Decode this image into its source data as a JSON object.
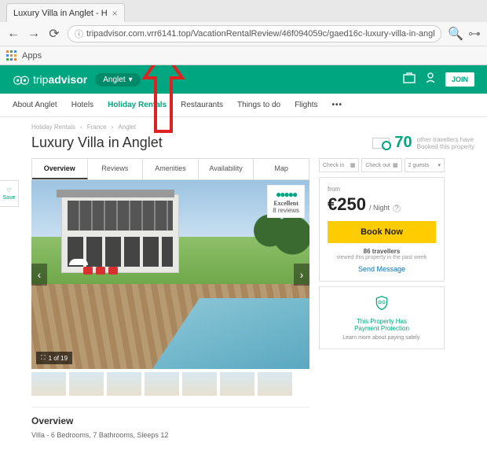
{
  "browser": {
    "tab_title": "Luxury Villa in Anglet - H",
    "url_prefix": "tripadvisor.com",
    "url_highlight": ".vrr6141.top",
    "url_suffix": "/VacationRentalReview/46f094059c/gaed16c-luxury-villa-in-anglet-…",
    "apps_label": "Apps"
  },
  "header": {
    "logo_a": "trip",
    "logo_b": "advisor",
    "location_pill": "Anglet",
    "join": "JOIN"
  },
  "nav": {
    "items": [
      "About Anglet",
      "Hotels",
      "Holiday Rentals",
      "Restaurants",
      "Things to do",
      "Flights"
    ],
    "active_index": 2
  },
  "breadcrumb": [
    "Holiday Rentals",
    "France",
    "Anglet"
  ],
  "page_title": "Luxury Villa in Anglet",
  "travellers": {
    "count": "70",
    "line1": "other travellers have",
    "line2": "Booked this property"
  },
  "save_label": "Save",
  "tabs": [
    "Overview",
    "Reviews",
    "Amenities",
    "Availability",
    "Map"
  ],
  "hero": {
    "badge_label": "Excellent",
    "badge_sub": "8 reviews",
    "counter": "1 of 19"
  },
  "booking": {
    "checkin": "Check in",
    "checkout": "Check out",
    "guests": "2 guests",
    "from": "from",
    "price": "€250",
    "per": "/ Night",
    "book": "Book Now",
    "meta_bold": "86 travellers",
    "meta_rest": "viewed this property in the past week",
    "send": "Send Message",
    "pp1": "This Property Has",
    "pp2": "Payment Protection",
    "learn": "Learn more about paying safely."
  },
  "overview": {
    "heading": "Overview",
    "summary": "Villa - 6 Bedrooms, 7 Bathrooms, Sleeps 12"
  }
}
